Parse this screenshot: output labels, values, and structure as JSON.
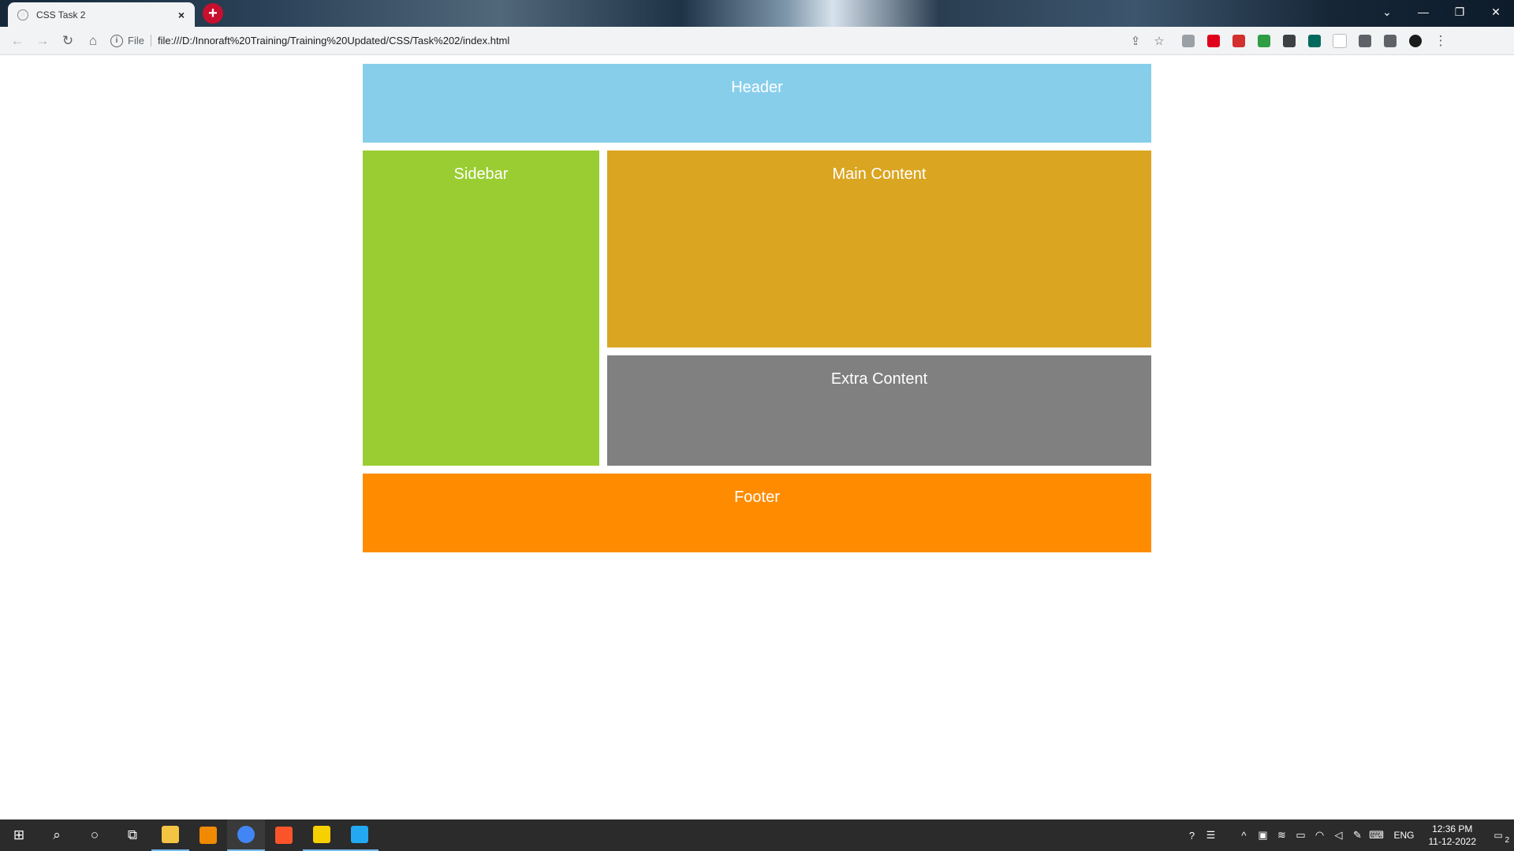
{
  "browser": {
    "tab": {
      "title": "CSS Task 2",
      "close_glyph": "×"
    },
    "new_tab_glyph": "+",
    "window_controls": {
      "tabsearch": "⌄",
      "minimize": "—",
      "restore": "❐",
      "close": "✕"
    },
    "nav": {
      "back": "←",
      "forward": "→",
      "reload": "↻",
      "home": "⌂"
    },
    "omnibox": {
      "info_glyph": "i",
      "scheme_label": "File",
      "url": "file:///D:/Innoraft%20Training/Training%20Updated/CSS/Task%202/index.html",
      "share_glyph": "⇪",
      "star_glyph": "☆"
    },
    "extensions": [
      {
        "name": "clipboard-ext-icon",
        "color": "#9aa0a6"
      },
      {
        "name": "opera-ext-icon",
        "color": "#e0001b"
      },
      {
        "name": "slash-ext-icon",
        "color": "#d32f2f"
      },
      {
        "name": "green-ext-icon",
        "color": "#2e9d44"
      },
      {
        "name": "pip-ext-icon",
        "color": "#3c4043"
      },
      {
        "name": "camera-ext-icon",
        "color": "#00695c"
      },
      {
        "name": "b-ext-icon",
        "color": "#ffffff"
      },
      {
        "name": "puzzle-icon",
        "color": "#5f6368"
      },
      {
        "name": "sidepanel-icon",
        "color": "#5f6368"
      },
      {
        "name": "profile-avatar",
        "color": "#1b1b1b"
      }
    ],
    "menu_glyph": "⋮"
  },
  "page": {
    "header": {
      "label": "Header",
      "color": "#87ceeb"
    },
    "sidebar": {
      "label": "Sidebar",
      "color": "#9acd32"
    },
    "main": {
      "label": "Main Content",
      "color": "#daa520"
    },
    "extra": {
      "label": "Extra Content",
      "color": "#808080"
    },
    "footer": {
      "label": "Footer",
      "color": "#ff8c00"
    }
  },
  "taskbar": {
    "start_glyph": "⊞",
    "search_glyph": "⌕",
    "cortana_glyph": "○",
    "taskview_glyph": "⧉",
    "apps": [
      {
        "name": "file-explorer-icon",
        "color": "#f4c542"
      },
      {
        "name": "vlc-icon",
        "color": "#f08a00"
      },
      {
        "name": "chrome-icon",
        "color": "#4285f4"
      },
      {
        "name": "brave-icon",
        "color": "#fb542b"
      },
      {
        "name": "sticky-notes-icon",
        "color": "#f7d000"
      },
      {
        "name": "vscode-icon",
        "color": "#23a9f2"
      }
    ],
    "tray": {
      "help_glyph": "?",
      "weather_glyph": "☰",
      "chevron_glyph": "^",
      "lang": "ENG",
      "time": "12:36 PM",
      "date": "11-12-2022",
      "notification_count": "2"
    }
  }
}
